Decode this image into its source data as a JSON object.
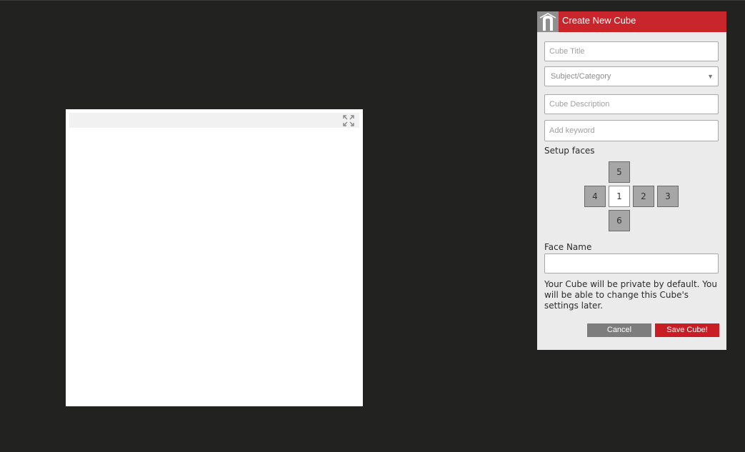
{
  "preview": {
    "expand_icon": "expand-arrows-icon"
  },
  "dialog": {
    "title": "Create New Cube",
    "logo_icon": "arch-logo-icon",
    "cube_title_placeholder": "Cube Title",
    "subject_label": "Subject/Category",
    "description_placeholder": "Cube Description",
    "keyword_placeholder": "Add keyword",
    "setup_faces_label": "Setup faces",
    "faces": {
      "f1": "1",
      "f2": "2",
      "f3": "3",
      "f4": "4",
      "f5": "5",
      "f6": "6"
    },
    "selected_face": "1",
    "face_name_label": "Face Name",
    "face_name_value": "",
    "privacy_note": "Your Cube will be private by default. You will be able to change this Cube's settings later.",
    "cancel_label": "Cancel",
    "save_label": "Save Cube!"
  },
  "colors": {
    "background": "#222220",
    "header_red": "#c8252c",
    "save_red": "#c81d24",
    "cancel_gray": "#7d7d7d"
  }
}
